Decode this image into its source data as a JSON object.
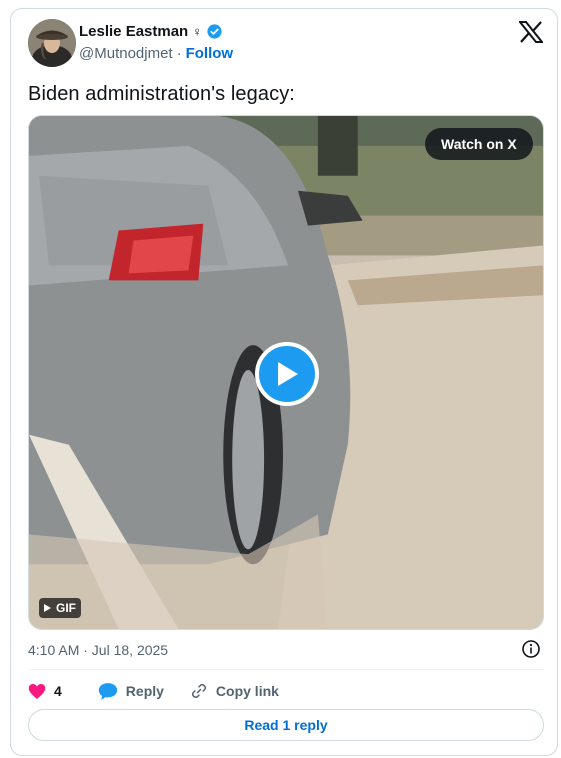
{
  "author": {
    "display_name": "Leslie Eastman",
    "gender_symbol": "♀",
    "handle": "@Mutnodjmet",
    "separator": "·",
    "follow_label": "Follow"
  },
  "tweet": {
    "text": "Biden administration's legacy:",
    "timestamp": "4:10 AM · Jul 18, 2025"
  },
  "media": {
    "watch_label": "Watch on X",
    "badge_label": "GIF"
  },
  "actions": {
    "like_count": "4",
    "reply_label": "Reply",
    "copy_label": "Copy link"
  },
  "read_replies_label": "Read 1 reply",
  "colors": {
    "accent": "#1d9bf0",
    "link": "#006fd6",
    "like": "#f91880",
    "secondary_text": "#536471"
  },
  "icons": [
    "verified-badge-icon",
    "x-logo-icon",
    "play-icon",
    "info-icon",
    "heart-icon",
    "reply-icon",
    "link-icon"
  ]
}
